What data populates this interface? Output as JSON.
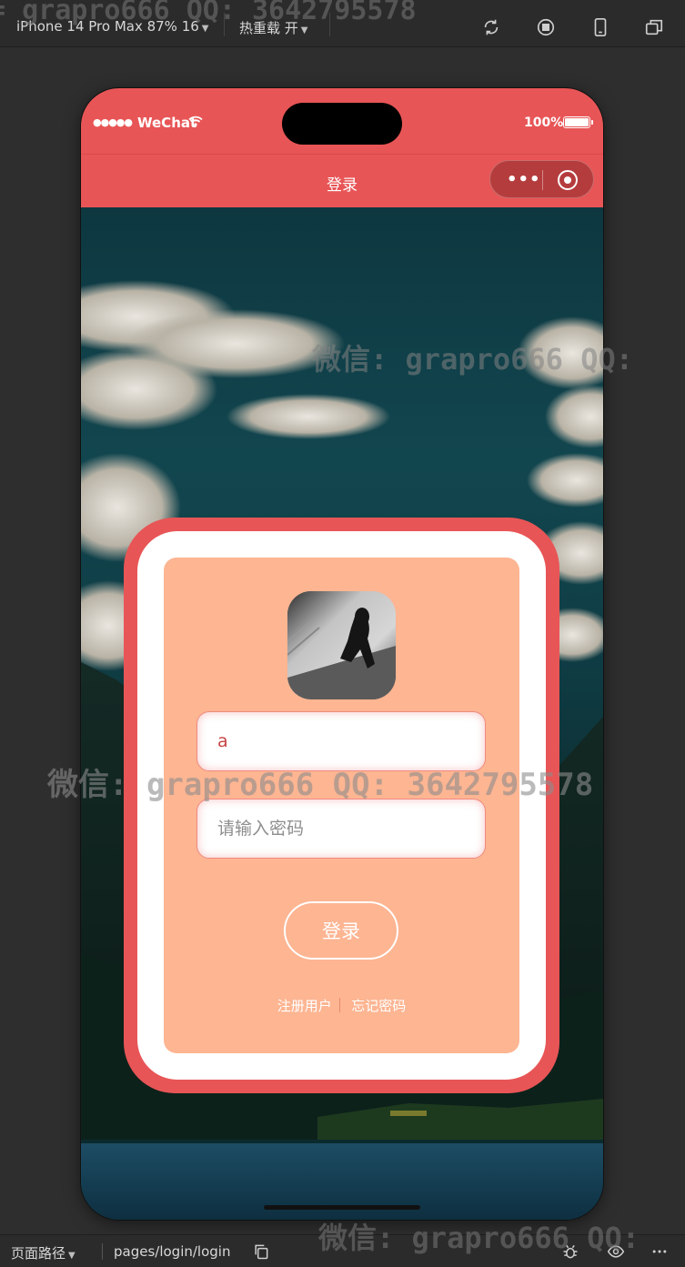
{
  "devtools": {
    "device_label": "iPhone 14 Pro Max 87% 16",
    "hot_reload_label": "热重载 开",
    "icons": [
      "refresh-icon",
      "stop-icon",
      "phone-icon",
      "window-icon"
    ]
  },
  "status_bar": {
    "carrier": "WeChat",
    "battery": "100%"
  },
  "navbar": {
    "title": "登录"
  },
  "login": {
    "username_value": "a",
    "password_placeholder": "请输入密码",
    "login_button": "登录",
    "register_link": "注册用户",
    "forgot_link": "忘记密码"
  },
  "bottom_bar": {
    "path_label": "页面路径",
    "path_value": "pages/login/login",
    "icons": [
      "copy-icon",
      "bug-icon",
      "eye-icon",
      "more-icon"
    ]
  },
  "watermarks": {
    "top": "= grapro666 QQ: 3642795578",
    "middle_right": "微信: grapro666 QQ:",
    "center": "微信: grapro666 QQ: 3642795578",
    "bottom": "微信: grapro666 QQ:"
  },
  "colors": {
    "accent": "#e85556",
    "card_inner": "#fdb592",
    "toolbar": "#2b2b2b"
  }
}
